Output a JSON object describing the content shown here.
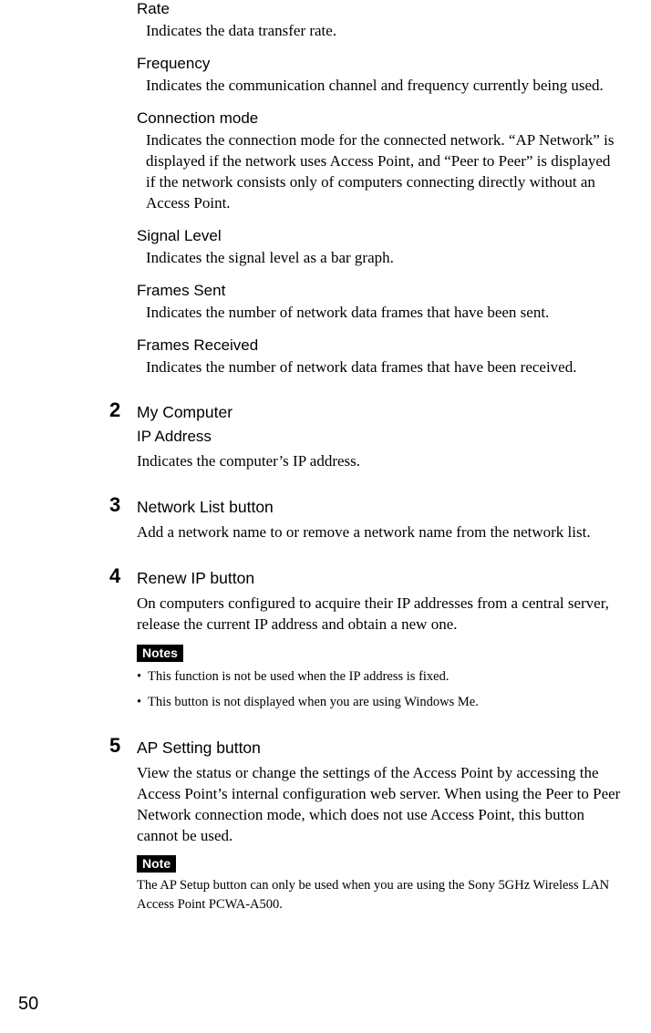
{
  "definitions": [
    {
      "term": "Rate",
      "desc": "Indicates the data transfer rate."
    },
    {
      "term": "Frequency",
      "desc": "Indicates the communication channel and frequency currently being used."
    },
    {
      "term": "Connection mode",
      "desc": "Indicates the connection mode for the connected network. “AP Network” is displayed if the network uses Access Point, and “Peer to Peer” is displayed if the network consists only of computers connecting directly without an Access Point."
    },
    {
      "term": "Signal Level",
      "desc": "Indicates the signal level as a bar graph."
    },
    {
      "term": "Frames Sent",
      "desc": "Indicates the number of network data frames that have been sent."
    },
    {
      "term": "Frames Received",
      "desc": "Indicates the number of network data frames that have been received."
    }
  ],
  "sections": {
    "s2": {
      "number": "2",
      "title": "My Computer",
      "subhead": "IP Address",
      "body": "Indicates the computer’s IP address."
    },
    "s3": {
      "number": "3",
      "title": "Network List button",
      "body": "Add a network name to or remove a network name from the network list."
    },
    "s4": {
      "number": "4",
      "title": "Renew IP button",
      "body": "On computers configured to acquire their IP addresses from a central server, release the current IP address and obtain a new one.",
      "notes_label": "Notes",
      "notes": [
        "This function is not be used when the IP address is fixed.",
        "This button is not displayed when you are using Windows Me."
      ]
    },
    "s5": {
      "number": "5",
      "title": "AP Setting button",
      "body": "View the status or change the settings of the Access Point by accessing the Access Point’s internal configuration web server. When using the Peer to Peer Network connection mode, which does not use Access Point, this button cannot be used.",
      "note_label": "Note",
      "note_text": "The AP Setup button can only be used when you are using the Sony 5GHz Wireless LAN Access Point PCWA-A500."
    }
  },
  "page_number": "50"
}
